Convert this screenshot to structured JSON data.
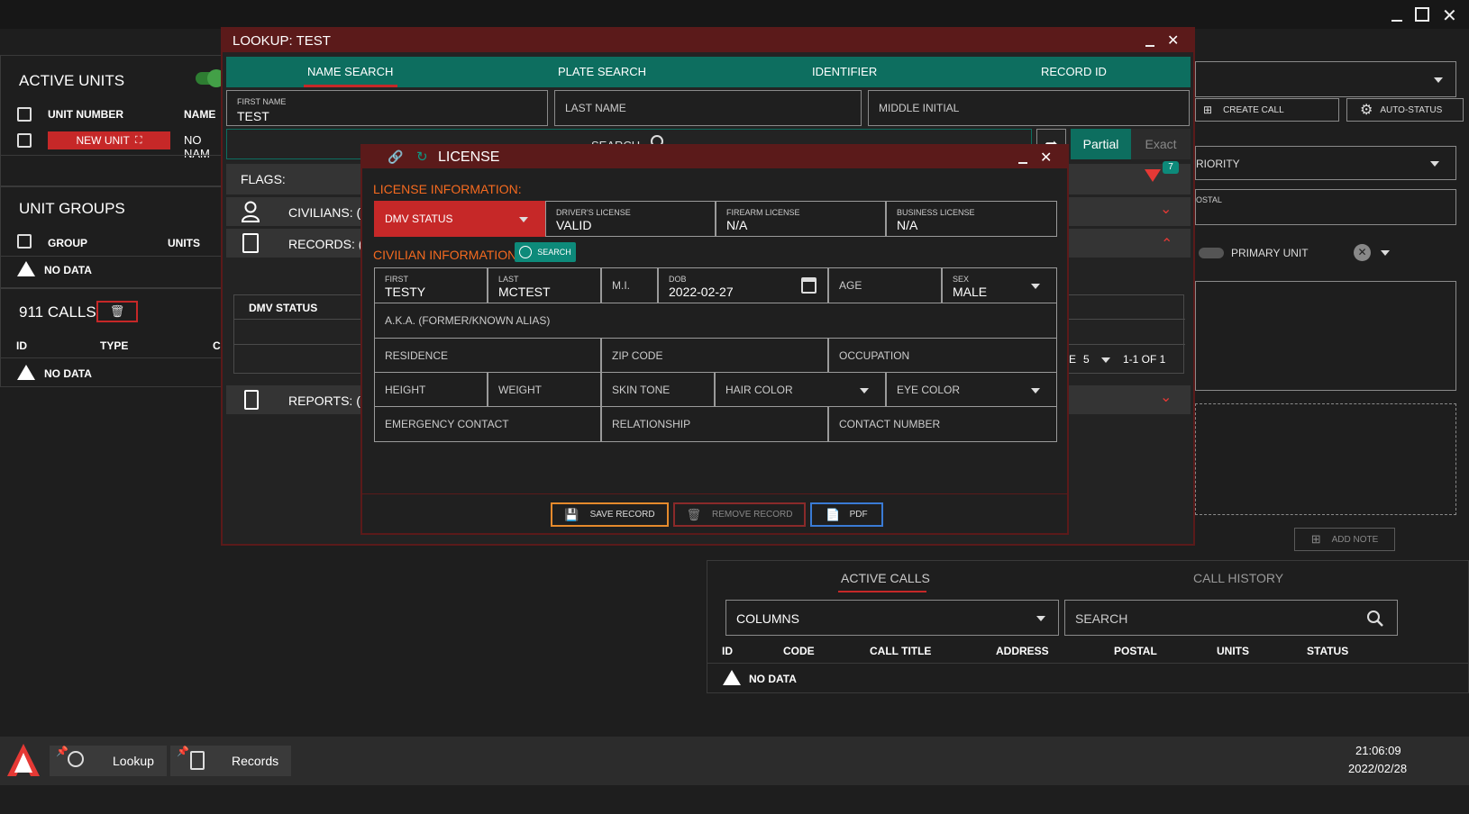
{
  "window_controls": {
    "minimize": "_",
    "maximize": "□",
    "close": "✕"
  },
  "left": {
    "active_units": {
      "title": "ACTIVE UNITS",
      "col_unit_number": "UNIT NUMBER",
      "col_name": "NAME",
      "new_unit_label": "NEW UNIT",
      "name_value": "NO NAM"
    },
    "unit_groups": {
      "title": "UNIT GROUPS",
      "col_group": "GROUP",
      "col_units": "UNITS",
      "no_data": "NO DATA"
    },
    "calls911": {
      "title": "911 CALLS",
      "col_id": "ID",
      "col_type": "TYPE",
      "col_ca": "CA",
      "no_data": "NO DATA"
    }
  },
  "right": {
    "create_call": "CREATE CALL",
    "auto_status": "AUTO-STATUS",
    "priority": "RIORITY",
    "postal": "OSTAL",
    "primary_unit": "PRIMARY UNIT",
    "add_note": "ADD NOTE",
    "tabs": [
      "ACTIVE CALLS",
      "CALL HISTORY"
    ],
    "columns_label": "COLUMNS",
    "search_placeholder": "SEARCH",
    "headers": [
      "ID",
      "CODE",
      "CALL TITLE",
      "ADDRESS",
      "POSTAL",
      "UNITS",
      "STATUS"
    ],
    "no_data": "NO DATA"
  },
  "lookup": {
    "title": "LOOKUP: TEST",
    "tabs": [
      "NAME SEARCH",
      "PLATE SEARCH",
      "IDENTIFIER",
      "RECORD ID"
    ],
    "first_name_label": "FIRST NAME",
    "first_name_value": "TEST",
    "last_name_placeholder": "LAST NAME",
    "middle_initial_placeholder": "MIDDLE INITIAL",
    "search_label": "SEARCH",
    "partial": "Partial",
    "exact": "Exact",
    "flags": "FLAGS:",
    "filter_count": "7",
    "civilians": "CIVILIANS: (",
    "records": "RECORDS: (",
    "dmv_status": "DMV STATUS",
    "pagination_e": "E",
    "per_page": "5",
    "range": "1-1 OF 1",
    "reports": "REPORTS: ("
  },
  "license": {
    "title": "LICENSE",
    "license_info": "LICENSE INFORMATION:",
    "dmv_status": "DMV STATUS",
    "drivers_license_label": "DRIVER'S LICENSE",
    "drivers_license_value": "VALID",
    "firearm_label": "FIREARM LICENSE",
    "firearm_value": "N/A",
    "business_label": "BUSINESS LICENSE",
    "business_value": "N/A",
    "civilian_info": "CIVILIAN INFORMATION",
    "search_btn": "SEARCH",
    "first_label": "FIRST",
    "first_value": "TESTY",
    "last_label": "LAST",
    "last_value": "MCTEST",
    "mi": "M.I.",
    "dob_label": "DOB",
    "dob_value": "2022-02-27",
    "age": "AGE",
    "sex_label": "SEX",
    "sex_value": "MALE",
    "aka": "A.K.A. (FORMER/KNOWN ALIAS)",
    "residence": "RESIDENCE",
    "zip": "ZIP CODE",
    "occupation": "OCCUPATION",
    "height": "HEIGHT",
    "weight": "WEIGHT",
    "skin": "SKIN TONE",
    "hair": "HAIR COLOR",
    "eye": "EYE COLOR",
    "emergency": "EMERGENCY CONTACT",
    "relationship": "RELATIONSHIP",
    "contact": "CONTACT NUMBER",
    "save": "SAVE RECORD",
    "remove": "REMOVE RECORD",
    "pdf": "PDF"
  },
  "taskbar": {
    "lookup": "Lookup",
    "records": "Records",
    "time": "21:06:09",
    "date": "2022/02/28"
  },
  "colors": {
    "titlebar_red": "#5b1a1a",
    "teal": "#0d6e5f",
    "accent_red": "#c62828",
    "orange": "#f56a1f",
    "save_border": "#e58a2c",
    "pdf_border": "#3a7bd5"
  }
}
